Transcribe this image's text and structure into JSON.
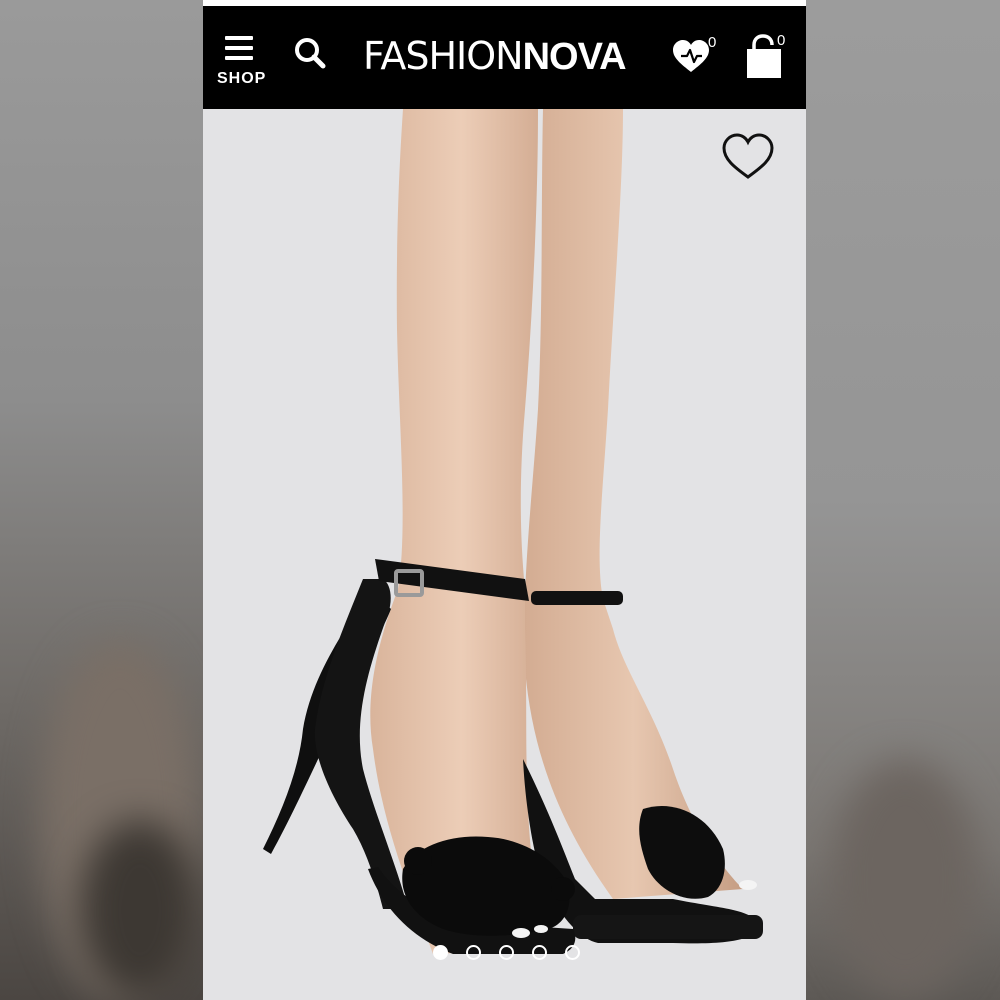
{
  "header": {
    "menu_label": "SHOP",
    "logo_light": "FASHION",
    "logo_bold": "NOVA",
    "wishlist_count": "0",
    "bag_count": "0"
  },
  "product_image": {
    "description_icon": "product-photo",
    "slide_count": 5,
    "active_slide": 1
  },
  "colors": {
    "header_bg": "#000000",
    "image_bg": "#e3e3e5",
    "accent": "#ffffff"
  }
}
